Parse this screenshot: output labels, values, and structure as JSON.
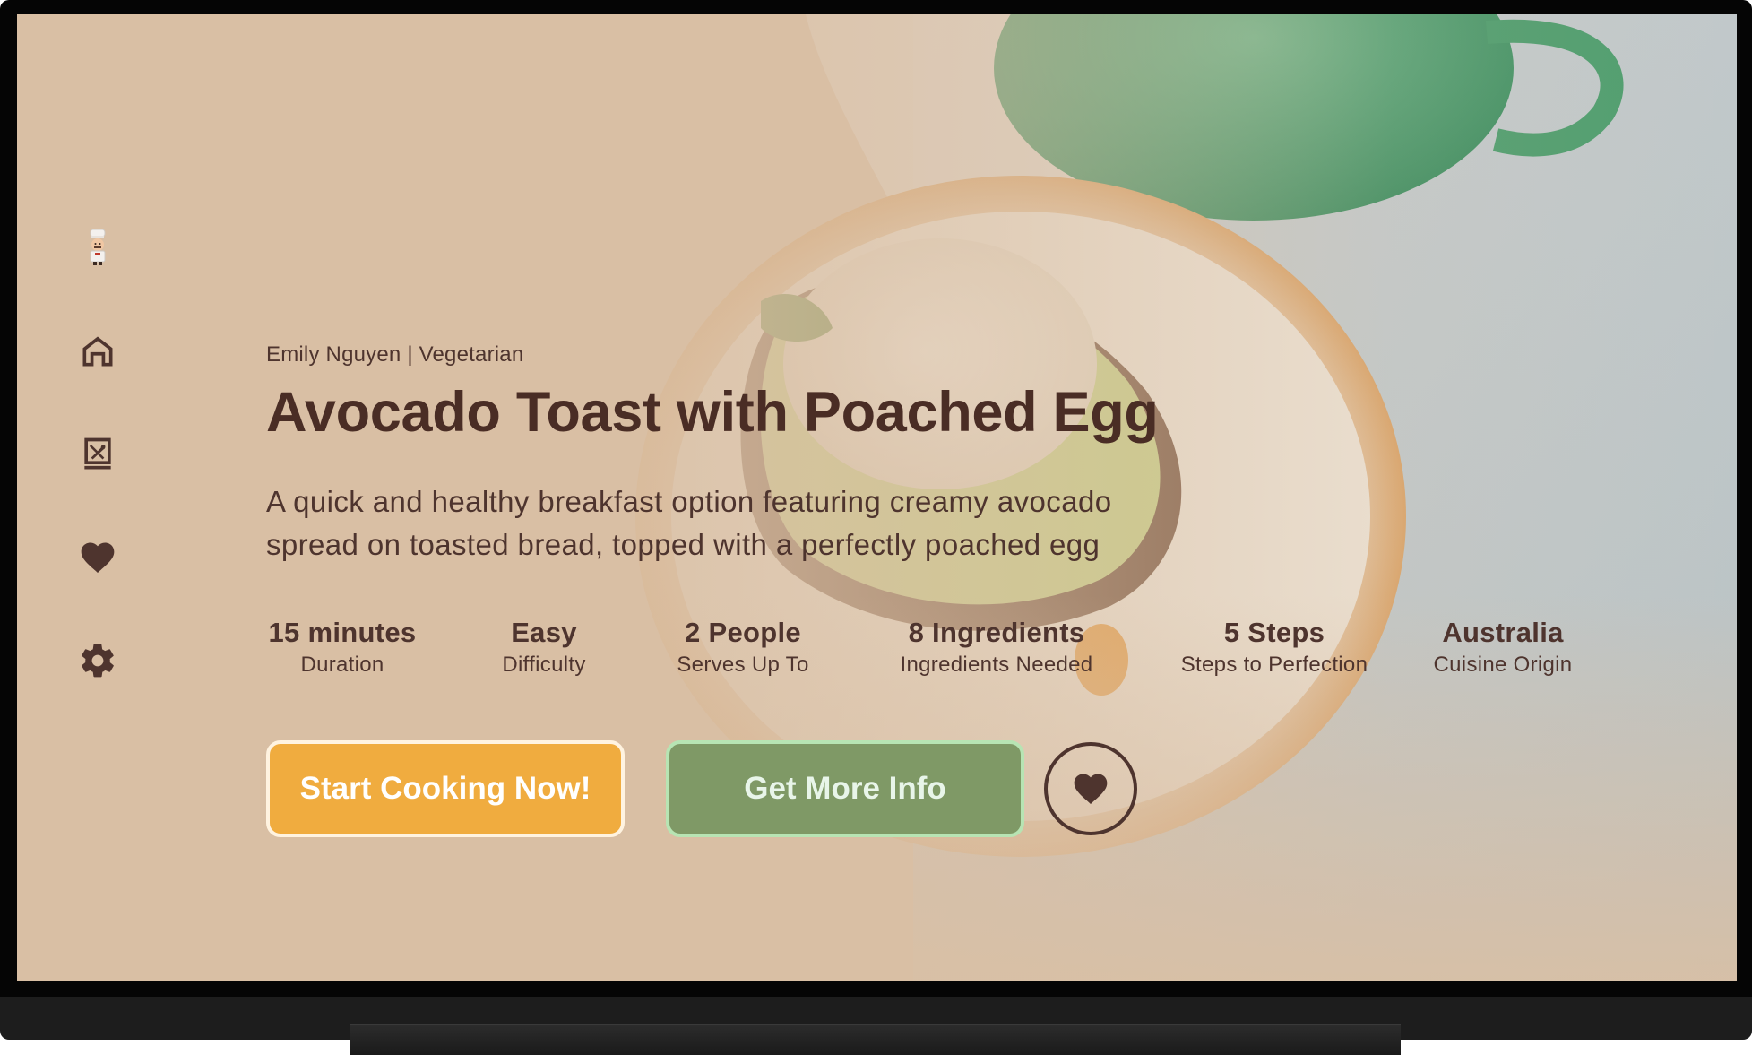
{
  "nav": {
    "items": [
      {
        "id": "profile",
        "icon": "chef-avatar-icon"
      },
      {
        "id": "home",
        "icon": "home-icon"
      },
      {
        "id": "recipes",
        "icon": "recipe-book-icon"
      },
      {
        "id": "favorites",
        "icon": "heart-icon"
      },
      {
        "id": "settings",
        "icon": "gear-icon"
      }
    ]
  },
  "recipe": {
    "meta": "Emily Nguyen | Vegetarian",
    "title": "Avocado Toast with Poached Egg",
    "description": "A quick and healthy breakfast option featuring creamy avocado spread on toasted bread, topped with a perfectly poached egg",
    "stats": [
      {
        "value": "15 minutes",
        "label": "Duration"
      },
      {
        "value": "Easy",
        "label": "Difficulty"
      },
      {
        "value": "2 People",
        "label": "Serves Up To"
      },
      {
        "value": "8 Ingredients",
        "label": "Ingredients Needed"
      },
      {
        "value": "5 Steps",
        "label": "Steps to Perfection"
      },
      {
        "value": "Australia",
        "label": "Cuisine Origin"
      }
    ]
  },
  "actions": {
    "primary_label": "Start Cooking Now!",
    "secondary_label": "Get More Info",
    "favorite_icon": "heart-icon"
  },
  "colors": {
    "background": "#d9bfa4",
    "text": "#4e342e",
    "primary_button": "#f0ac3f",
    "secondary_button": "#7f9966",
    "secondary_border": "#b7e4b3"
  }
}
